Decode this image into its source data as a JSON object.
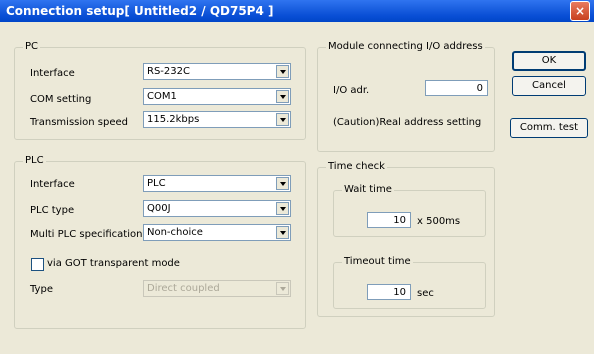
{
  "window": {
    "title": "Connection setup[ Untitled2 / QD75P4 ]",
    "close_icon": "×"
  },
  "pc": {
    "legend": "PC",
    "interface_label": "Interface",
    "interface_value": "RS-232C",
    "com_label": "COM setting",
    "com_value": "COM1",
    "speed_label": "Transmission speed",
    "speed_value": "115.2kbps"
  },
  "plc": {
    "legend": "PLC",
    "interface_label": "Interface",
    "interface_value": "PLC",
    "type_label": "PLC type",
    "type_value": "Q00J",
    "multi_label": "Multi PLC specification",
    "multi_value": "Non-choice",
    "got_label": "via GOT transparent mode",
    "got_type_label": "Type",
    "got_type_value": "Direct coupled"
  },
  "module": {
    "legend": "Module connecting I/O address",
    "io_label": "I/O adr.",
    "io_value": "0",
    "caution": "(Caution)Real address setting"
  },
  "time_check": {
    "legend": "Time check",
    "wait_legend": "Wait time",
    "wait_value": "10",
    "wait_unit": "x 500ms",
    "timeout_legend": "Timeout time",
    "timeout_value": "10",
    "timeout_unit": "sec"
  },
  "buttons": {
    "ok": "OK",
    "cancel": "Cancel",
    "comm_test": "Comm. test"
  }
}
